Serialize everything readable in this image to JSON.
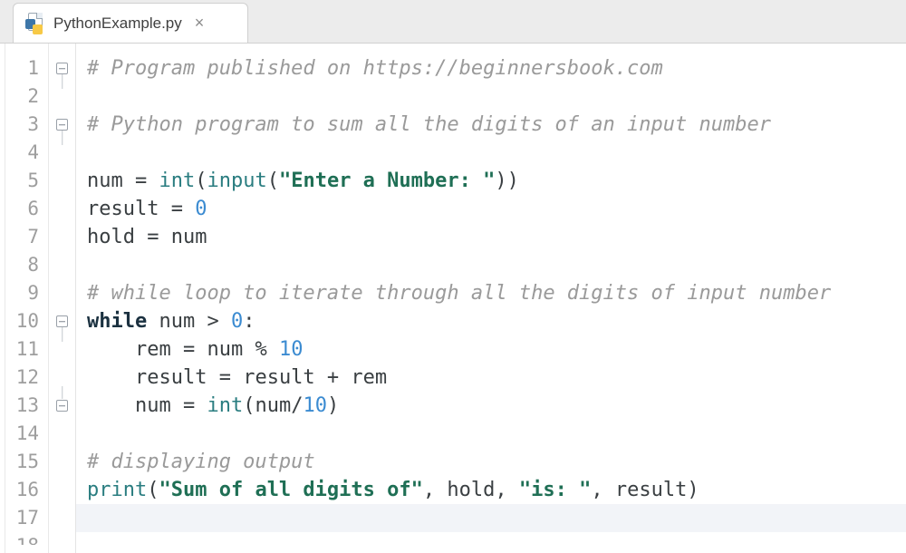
{
  "tab": {
    "filename": "PythonExample.py",
    "icon": "python-file-icon"
  },
  "editor": {
    "language": "python",
    "current_line": 17,
    "lines": [
      {
        "n": 1,
        "fold": "open-top",
        "tokens": [
          [
            "cmt",
            "# Program published on https://beginnersbook.com"
          ]
        ]
      },
      {
        "n": 2,
        "fold": null,
        "tokens": []
      },
      {
        "n": 3,
        "fold": "open-top",
        "tokens": [
          [
            "cmt",
            "# Python program to sum all the digits of an input number"
          ]
        ]
      },
      {
        "n": 4,
        "fold": null,
        "tokens": []
      },
      {
        "n": 5,
        "fold": null,
        "tokens": [
          [
            "id",
            "num "
          ],
          [
            "op",
            "= "
          ],
          [
            "bi",
            "int"
          ],
          [
            "op",
            "("
          ],
          [
            "bi",
            "input"
          ],
          [
            "op",
            "("
          ],
          [
            "str",
            "\"Enter a Number: \""
          ],
          [
            "op",
            "))"
          ]
        ]
      },
      {
        "n": 6,
        "fold": null,
        "tokens": [
          [
            "id",
            "result "
          ],
          [
            "op",
            "= "
          ],
          [
            "num",
            "0"
          ]
        ]
      },
      {
        "n": 7,
        "fold": null,
        "tokens": [
          [
            "id",
            "hold "
          ],
          [
            "op",
            "= "
          ],
          [
            "id",
            "num"
          ]
        ]
      },
      {
        "n": 8,
        "fold": null,
        "tokens": []
      },
      {
        "n": 9,
        "fold": null,
        "tokens": [
          [
            "cmt",
            "# while loop to iterate through all the digits of input number"
          ]
        ]
      },
      {
        "n": 10,
        "fold": "open-top",
        "tokens": [
          [
            "kw",
            "while"
          ],
          [
            "id",
            " num "
          ],
          [
            "op",
            "> "
          ],
          [
            "num",
            "0"
          ],
          [
            "op",
            ":"
          ]
        ]
      },
      {
        "n": 11,
        "fold": null,
        "tokens": [
          [
            "id",
            "    rem "
          ],
          [
            "op",
            "= "
          ],
          [
            "id",
            "num "
          ],
          [
            "op",
            "% "
          ],
          [
            "num",
            "10"
          ]
        ]
      },
      {
        "n": 12,
        "fold": null,
        "tokens": [
          [
            "id",
            "    result "
          ],
          [
            "op",
            "= "
          ],
          [
            "id",
            "result "
          ],
          [
            "op",
            "+ "
          ],
          [
            "id",
            "rem"
          ]
        ]
      },
      {
        "n": 13,
        "fold": "open-bot",
        "tokens": [
          [
            "id",
            "    num "
          ],
          [
            "op",
            "= "
          ],
          [
            "bi",
            "int"
          ],
          [
            "op",
            "("
          ],
          [
            "id",
            "num"
          ],
          [
            "op",
            "/"
          ],
          [
            "num",
            "10"
          ],
          [
            "op",
            ")"
          ]
        ]
      },
      {
        "n": 14,
        "fold": null,
        "tokens": []
      },
      {
        "n": 15,
        "fold": null,
        "tokens": [
          [
            "cmt",
            "# displaying output"
          ]
        ]
      },
      {
        "n": 16,
        "fold": null,
        "tokens": [
          [
            "bi",
            "print"
          ],
          [
            "op",
            "("
          ],
          [
            "str",
            "\"Sum of all digits of\""
          ],
          [
            "op",
            ", "
          ],
          [
            "id",
            "hold"
          ],
          [
            "op",
            ", "
          ],
          [
            "str",
            "\"is: \""
          ],
          [
            "op",
            ", "
          ],
          [
            "id",
            "result"
          ],
          [
            "op",
            ")"
          ]
        ]
      },
      {
        "n": 17,
        "fold": null,
        "tokens": []
      }
    ]
  }
}
